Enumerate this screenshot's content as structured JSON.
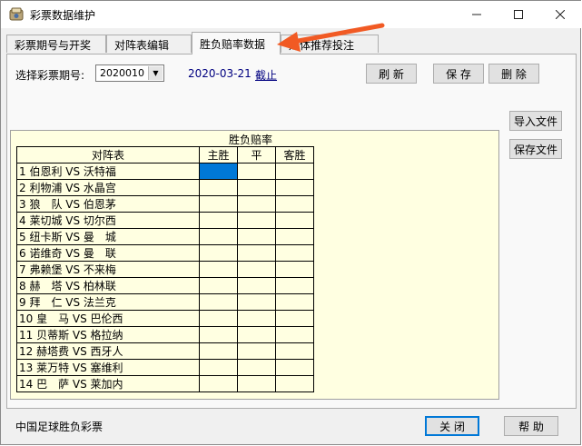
{
  "window": {
    "title": "彩票数据维护",
    "controls": [
      "minimize-icon",
      "maximize-icon",
      "close-icon"
    ]
  },
  "tabs": [
    {
      "label": "彩票期号与开奖",
      "active": false
    },
    {
      "label": "对阵表编辑",
      "active": false
    },
    {
      "label": "胜负赔率数据",
      "active": true
    },
    {
      "label": "媒体推荐投注",
      "active": false
    }
  ],
  "form": {
    "period_label": "选择彩票期号:",
    "period_value": "2020010",
    "date_text": "2020-03-21",
    "deadline_text": "截止",
    "date_color": "#000080",
    "refresh_label": "刷 新",
    "save_label": "保 存",
    "delete_label": "删 除"
  },
  "side_buttons": {
    "import_label": "导入文件",
    "save_file_label": "保存文件"
  },
  "grid": {
    "group_header": "胜负赔率",
    "columns": [
      "对阵表",
      "主胜",
      "平",
      "客胜"
    ],
    "rows": [
      "1 伯恩利 VS 沃特福",
      "2 利物浦 VS 水晶宫",
      "3 狼　队 VS 伯恩茅",
      "4 莱切城 VS 切尔西",
      "5 纽卡斯 VS 曼　城",
      "6 诺维奇 VS 曼　联",
      "7 弗赖堡 VS 不来梅",
      "8 赫　塔 VS 柏林联",
      "9 拜　仁 VS 法兰克",
      "10 皇　马 VS 巴伦西",
      "11 贝蒂斯 VS 格拉纳",
      "12 赫塔费 VS 西牙人",
      "13 莱万特 VS 塞维利",
      "14 巴　萨 VS 莱加内"
    ],
    "cell_bg": "#ffffe1",
    "selected_color": "#0078d7"
  },
  "footer": {
    "status_text": "中国足球胜负彩票",
    "close_label": "关 闭",
    "help_label": "帮 助"
  },
  "colors": {
    "annotation_arrow": "#f15a24",
    "accent": "#0078d7"
  }
}
